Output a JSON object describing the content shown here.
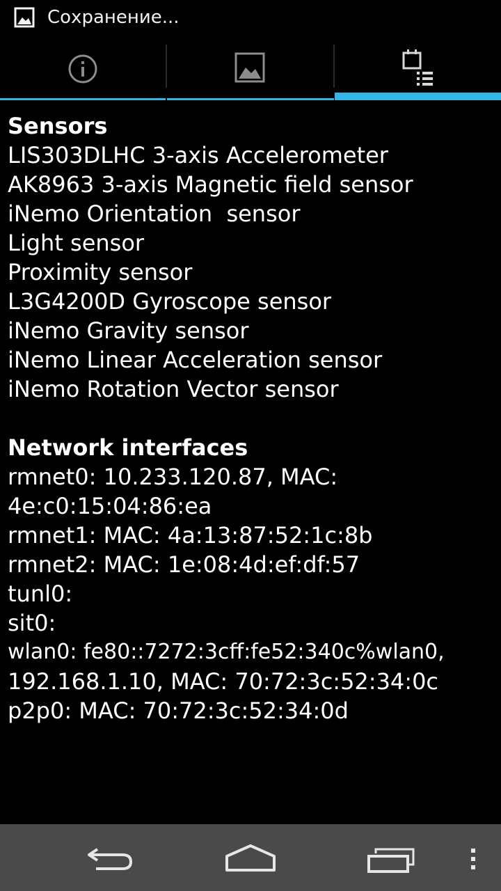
{
  "status_bar": {
    "icon": "image-icon",
    "text": "Сохранение..."
  },
  "tabs": [
    {
      "icon": "info-icon",
      "selected": false
    },
    {
      "icon": "image-icon",
      "selected": false
    },
    {
      "icon": "calendar-list-icon",
      "selected": true
    }
  ],
  "accent_color": "#33b5e5",
  "sensors": {
    "heading": "Sensors",
    "items": [
      "LIS303DLHC 3-axis Accelerometer",
      "AK8963 3-axis Magnetic field sensor",
      "iNemo Orientation  sensor",
      "Light sensor",
      "Proximity sensor",
      "L3G4200D Gyroscope sensor",
      "iNemo Gravity sensor",
      "iNemo Linear Acceleration sensor",
      "iNemo Rotation Vector sensor"
    ]
  },
  "network": {
    "heading": "Network interfaces",
    "lines": [
      "rmnet0: 10.233.120.87, MAC:",
      "4e:c0:15:04:86:ea",
      "rmnet1: MAC: 4a:13:87:52:1c:8b",
      "rmnet2: MAC: 1e:08:4d:ef:df:57",
      "tunl0:",
      "sit0:",
      "wlan0: fe80::7272:3cff:fe52:340c%wlan0,",
      "192.168.1.10, MAC: 70:72:3c:52:34:0c",
      "p2p0: MAC: 70:72:3c:52:34:0d"
    ]
  },
  "nav_bar": {
    "back": "back-icon",
    "home": "home-icon",
    "recents": "recents-icon",
    "menu": "overflow-menu-icon"
  }
}
